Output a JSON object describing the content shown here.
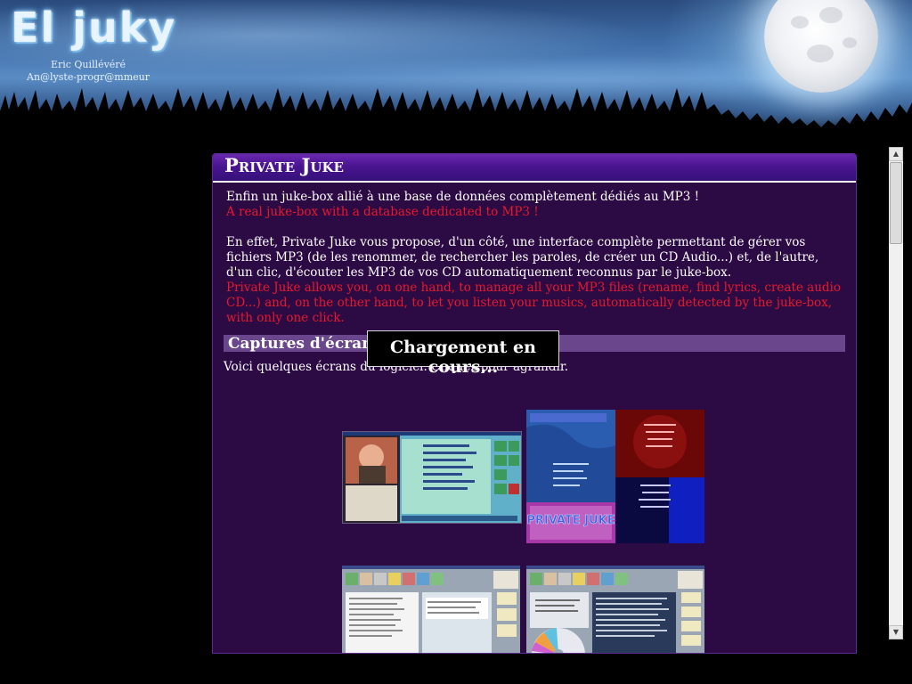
{
  "header": {
    "logo_text": "El juky",
    "author_name": "Eric Quillévéré",
    "author_email": "An@lyste-progr@mmeur"
  },
  "panel": {
    "title": "Private Juke",
    "intro_fr": "Enfin un juke-box allié à une base de données complètement dédiés au MP3 !",
    "intro_en": "A real juke-box with a database dedicated to MP3 !",
    "desc_fr": "En effet, Private Juke vous propose, d'un côté, une interface complète permettant de gérer vos fichiers MP3 (de les renommer, de rechercher les paroles, de créer un CD Audio...) et, de l'autre, d'un clic, d'écouter les MP3 de vos CD automatiquement reconnus par le juke-box.",
    "desc_en": "Private Juke allows you, on one hand, to manage all your MP3 files (rename, find lyrics, create audio CD...) and, on the other hand, to let you listen your musics, automatically detected by the juke-box, with only one click.",
    "captures_header": "Captures d'écran",
    "captures_intro": "Voici quelques écrans du logiciel. Cliquez pour agrandir."
  },
  "loading_text": "Chargement en cours...",
  "thumbnails": [
    {
      "name": "screenshot-main-interface"
    },
    {
      "name": "screenshot-jukebox-skins",
      "caption_text": "PRIVATE JUKE"
    },
    {
      "name": "screenshot-file-manager"
    },
    {
      "name": "screenshot-cd-creator"
    }
  ],
  "colors": {
    "panel_bg": "#2c0a44",
    "title_bar": "#4a1590",
    "english_text": "#e8192c",
    "section_header": "#6a468c"
  }
}
